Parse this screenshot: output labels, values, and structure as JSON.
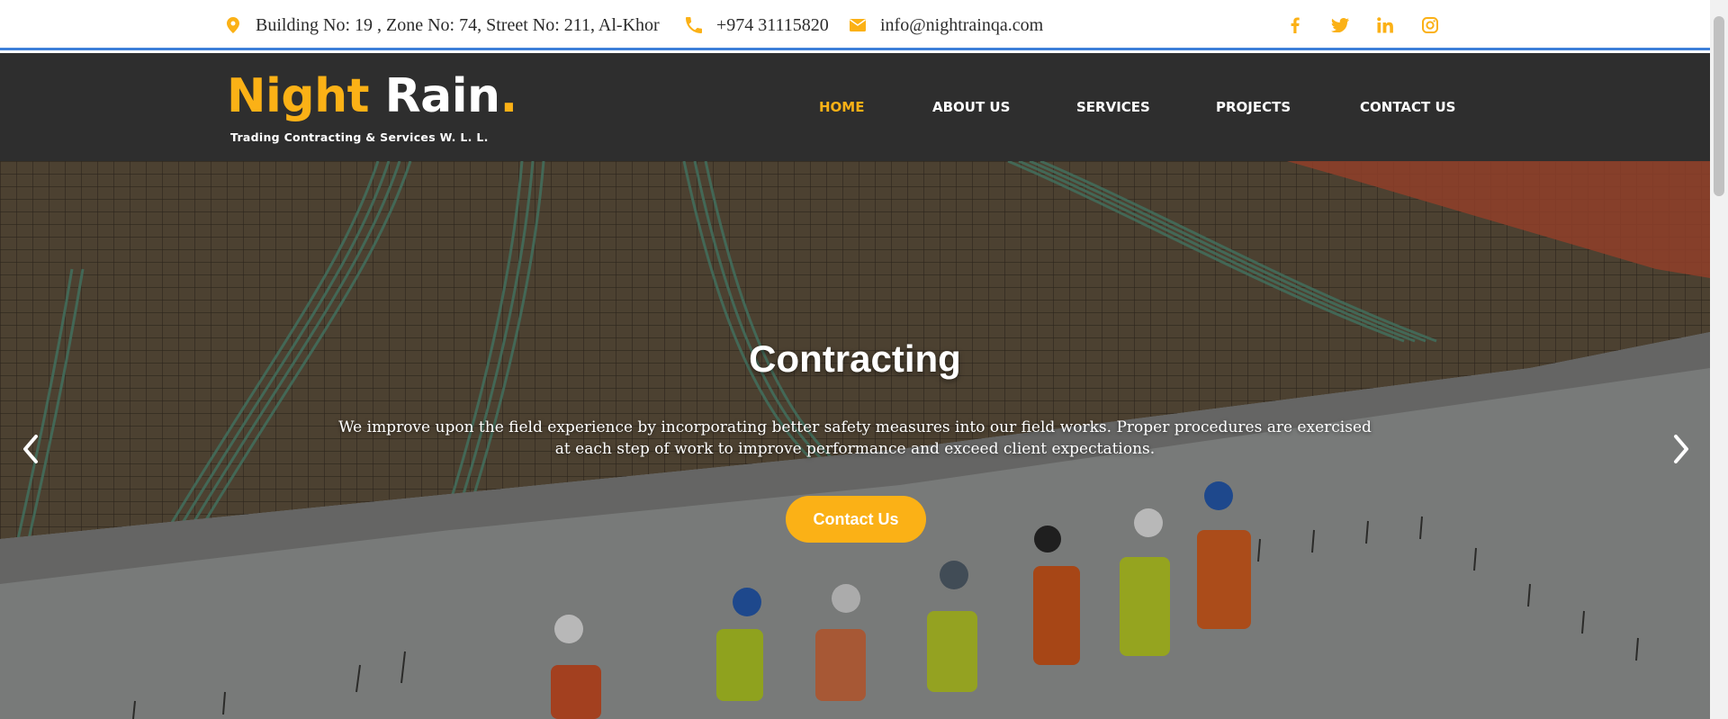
{
  "topbar": {
    "address": "Building No: 19 , Zone No: 74, Street No: 211, Al-Khor",
    "phone": "+974 31115820",
    "email": "info@nightrainqa.com",
    "address_icon": "map-pin-icon",
    "phone_icon": "phone-icon",
    "email_icon": "envelope-icon",
    "socials": [
      "facebook-icon",
      "twitter-icon",
      "linkedin-icon",
      "instagram-icon"
    ]
  },
  "logo": {
    "night": "Night",
    "rain": "Rain",
    "dot": ".",
    "tagline": "Trading Contracting & Services W. L. L."
  },
  "nav": {
    "items": [
      "HOME",
      "ABOUT US",
      "SERVICES",
      "PROJECTS",
      "CONTACT US"
    ],
    "active": "HOME"
  },
  "hero": {
    "title": "Contracting",
    "text": "We improve upon the field experience by incorporating better safety measures into our field works. Proper procedures are exercised at each step of work to improve performance and exceed client expectations.",
    "button": "Contact Us",
    "prev_icon": "chevron-left-icon",
    "next_icon": "chevron-right-icon"
  },
  "colors": {
    "accent": "#fbb116",
    "header_bg": "#2e2e2e",
    "topbar_border": "#3d7fd9"
  }
}
